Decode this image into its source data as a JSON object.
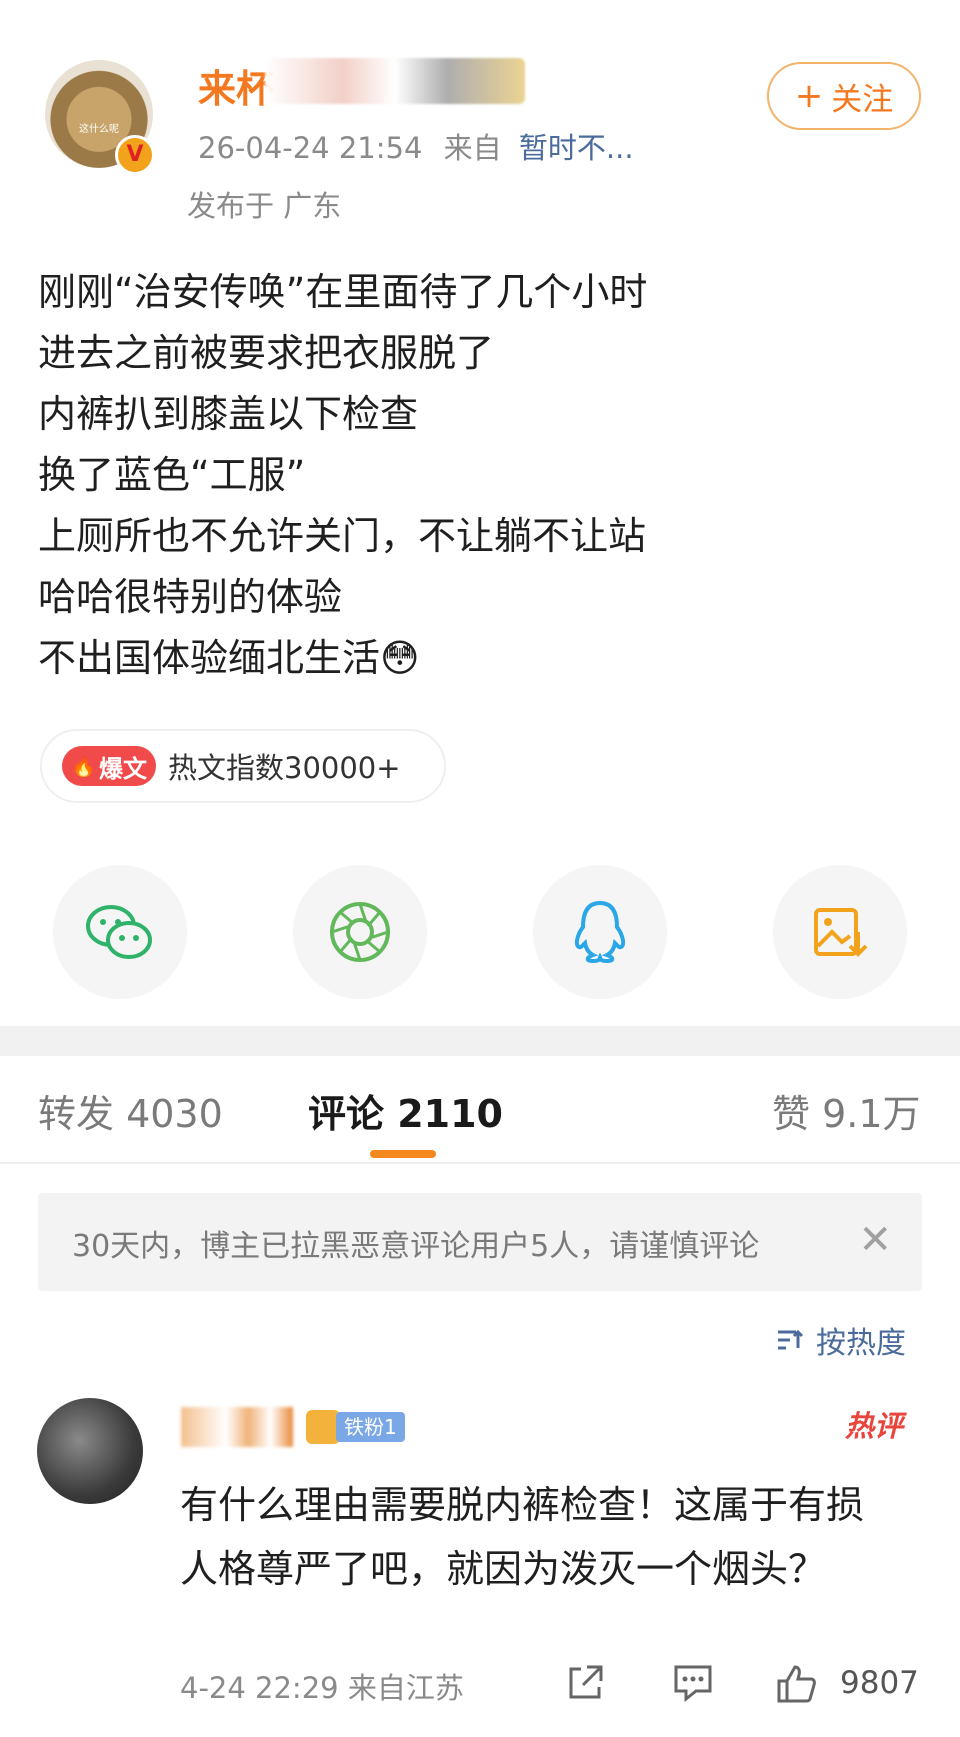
{
  "post": {
    "username": "来杯",
    "timestamp": "26-04-24 21:54",
    "from_label": "来自",
    "source": "暂时不...",
    "location": "发布于 广东",
    "avatar_caption": "这什么呢",
    "follow_label": "关注",
    "content_lines": [
      "刚刚“治安传唤”在里面待了几个小时",
      "进去之前被要求把衣服脱了",
      "内裤扒到膝盖以下检查",
      "换了蓝色“工服”",
      "上厕所也不允许关门，不让躺不让站",
      "哈哈很特别的体验",
      "不出国体验缅北生活😳"
    ],
    "hot_tag": "爆文",
    "hot_index": "热文指数30000+"
  },
  "share": [
    {
      "icon": "wechat-icon"
    },
    {
      "icon": "moments-icon"
    },
    {
      "icon": "qq-icon"
    },
    {
      "icon": "save-image-icon"
    }
  ],
  "tabs": {
    "repost": "转发 4030",
    "comments": "评论 2110",
    "likes": "赞 9.1万"
  },
  "notice": {
    "text": "30天内，博主已拉黑恶意评论用户5人，请谨慎评论",
    "close": "✕"
  },
  "sort_label": "按热度",
  "comment": {
    "fan_level": "铁粉1",
    "hot_badge": "热评",
    "text": "有什么理由需要脱内裤检查！这属于有损人格尊严了吧，就因为泼灭一个烟头？",
    "meta": "4-24 22:29 来自江苏",
    "likes": "9807"
  },
  "colors": {
    "accent_orange": "#f4781f",
    "link_blue": "#4a6b9c",
    "hot_red": "#f04a4a"
  }
}
